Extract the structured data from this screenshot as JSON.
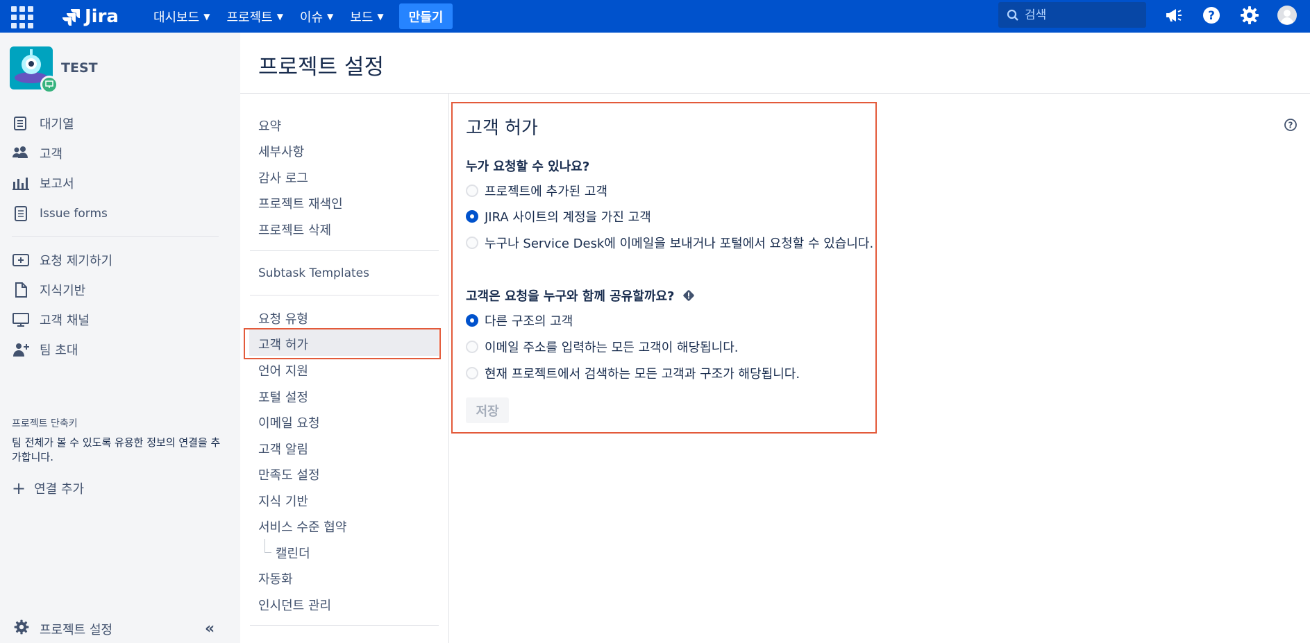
{
  "topnav": {
    "logo_text": "Jira",
    "menus": [
      {
        "label": "대시보드"
      },
      {
        "label": "프로젝트"
      },
      {
        "label": "이슈"
      },
      {
        "label": "보드"
      }
    ],
    "create_label": "만들기",
    "search_placeholder": "검색",
    "colors": {
      "bg": "#0052CC",
      "create": "#2684FF"
    }
  },
  "sidebar": {
    "project_name": "TEST",
    "items": [
      {
        "label": "대기열",
        "icon": "queue-icon"
      },
      {
        "label": "고객",
        "icon": "customers-icon"
      },
      {
        "label": "보고서",
        "icon": "reports-icon"
      },
      {
        "label": "Issue forms",
        "icon": "forms-icon"
      }
    ],
    "items2": [
      {
        "label": "요청 제기하기",
        "icon": "raise-request-icon"
      },
      {
        "label": "지식기반",
        "icon": "knowledge-base-icon"
      },
      {
        "label": "고객 채널",
        "icon": "channels-icon"
      },
      {
        "label": "팀 초대",
        "icon": "invite-team-icon"
      }
    ],
    "shortcut_title": "프로젝트 단축키",
    "shortcut_desc": "팀 전체가 볼 수 있도록 유용한 정보의 연결을 추가합니다.",
    "add_link": "연결 추가",
    "footer_label": "프로젝트 설정"
  },
  "page": {
    "title": "프로젝트 설정"
  },
  "settings_nav": {
    "group1": [
      "요약",
      "세부사항",
      "감사 로그",
      "프로젝트 재색인",
      "프로젝트 삭제"
    ],
    "group2": [
      "Subtask Templates"
    ],
    "group3": [
      "요청 유형",
      "고객 허가",
      "언어 지원",
      "포털 설정",
      "이메일 요청",
      "고객 알림",
      "만족도 설정",
      "지식 기반",
      "서비스 수준 협약",
      "캘린더",
      "자동화",
      "인시던트 관리"
    ],
    "selected": "고객 허가"
  },
  "content": {
    "title": "고객 허가",
    "q1": {
      "title": "누가 요청할 수 있나요?",
      "options": [
        {
          "label": "프로젝트에 추가된 고객",
          "checked": false
        },
        {
          "label": "JIRA 사이트의 계정을 가진 고객",
          "checked": true
        },
        {
          "label": "누구나 Service Desk에 이메일을 보내거나 포털에서 요청할 수 있습니다.",
          "checked": false
        }
      ]
    },
    "q2": {
      "title": "고객은 요청을 누구와 함께 공유할까요?",
      "options": [
        {
          "label": "다른 구조의 고객",
          "checked": true
        },
        {
          "label": "이메일 주소를 입력하는 모든 고객이 해당됩니다.",
          "checked": false
        },
        {
          "label": "현재 프로젝트에서 검색하는 모든 고객과 구조가 해당됩니다.",
          "checked": false
        }
      ]
    },
    "save_label": "저장"
  }
}
